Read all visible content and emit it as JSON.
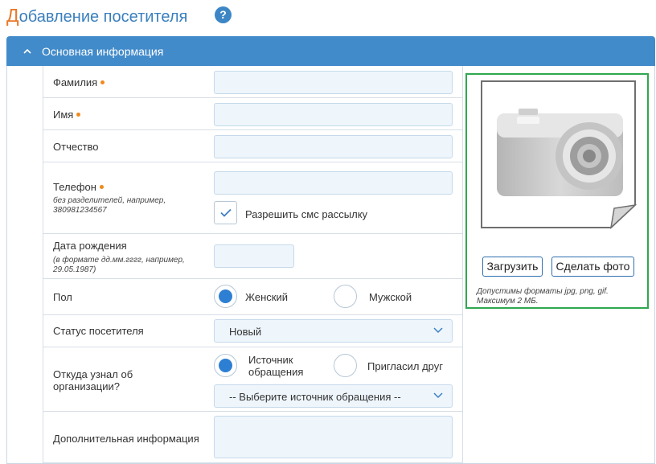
{
  "page": {
    "title_first_letter": "Д",
    "title_rest": "обавление посетителя",
    "help_glyph": "?"
  },
  "section": {
    "title": "Основная информация",
    "chevron": "^"
  },
  "form": {
    "last_name": {
      "label": "Фамилия",
      "required": true,
      "value": ""
    },
    "first_name": {
      "label": "Имя",
      "required": true,
      "value": ""
    },
    "middle_name": {
      "label": "Отчество",
      "required": false,
      "value": ""
    },
    "phone": {
      "label": "Телефон",
      "required": true,
      "hint": "без разделителей, например, 380981234567",
      "value": "",
      "sms_checkbox": {
        "label": "Разрешить смс рассылку",
        "checked": true
      }
    },
    "birth_date": {
      "label": "Дата рождения",
      "hint": "(в формате дд.мм.гггг, например, 29.05.1987)",
      "value": ""
    },
    "gender": {
      "label": "Пол",
      "options": [
        {
          "label": "Женский",
          "selected": true
        },
        {
          "label": "Мужской",
          "selected": false
        }
      ]
    },
    "status": {
      "label": "Статус посетителя",
      "value": "Новый"
    },
    "source": {
      "label": "Откуда узнал об организации?",
      "options": [
        {
          "label": "Источник обращения",
          "selected": true
        },
        {
          "label": "Пригласил друг",
          "selected": false
        }
      ],
      "select_value": "-- Выберите источник обращения --"
    },
    "extra_info": {
      "label": "Дополнительная информация",
      "value": ""
    }
  },
  "photo": {
    "upload_label": "Загрузить",
    "take_photo_label": "Сделать фото",
    "hint": "Допустимы форматы jpg, png, gif. Максимум 2 МБ."
  },
  "colors": {
    "accent": "#428bca",
    "title_accent": "#e8792a",
    "required_dot": "#f0891d",
    "input_bg": "#eef6fc",
    "photo_border": "#2fa84f",
    "radio_selected": "#2d7fd3"
  },
  "icons": {
    "help": "help-icon",
    "chevron_up": "chevron-up-icon",
    "chevron_down": "chevron-down-icon",
    "check": "check-icon",
    "camera": "camera-icon"
  }
}
